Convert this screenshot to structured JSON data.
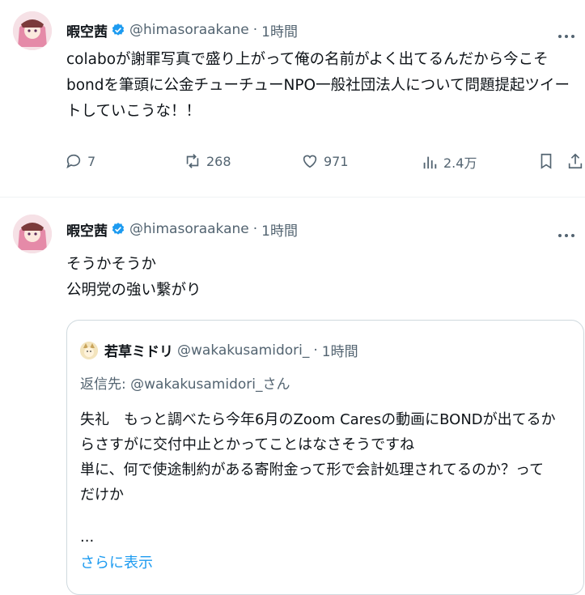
{
  "tweets": [
    {
      "name": "暇空茜",
      "handle": "@himasoraakane",
      "separator": "·",
      "time": "1時間",
      "lines": [
        "colaboが謝罪写真で盛り上がって俺の名前がよく出てるんだから今こそ",
        "bondを筆頭に公金チューチューNPO一般社団法人について問題提起ツイー",
        "トしていこうな！！"
      ],
      "actions": {
        "replies": "7",
        "retweets": "268",
        "likes": "971",
        "views": "2.4万"
      }
    },
    {
      "name": "暇空茜",
      "handle": "@himasoraakane",
      "separator": "·",
      "time": "1時間",
      "lines": [
        "そうかそうか",
        "公明党の強い繋がり"
      ],
      "quote": {
        "name": "若草ミドリ",
        "handle": "@wakakusamidori_",
        "separator": "·",
        "time": "1時間",
        "reply_prefix": "返信先: ",
        "reply_handle": "@wakakusamidori_",
        "reply_suffix": "さん",
        "lines": [
          "失礼　もっと調べたら今年6月のZoom Caresの動画にBONDが出てるか",
          "らさすがに交付中止とかってことはなさそうですね",
          "単に、何で使途制約がある寄附金って形で会計処理されてるのか？って",
          "だけか"
        ],
        "ellipsis": "...",
        "show_more": "さらに表示"
      }
    }
  ],
  "colors": {
    "text": "#0f1419",
    "secondary": "#536471",
    "accent": "#1d9bf0",
    "border": "#cfd9de"
  }
}
